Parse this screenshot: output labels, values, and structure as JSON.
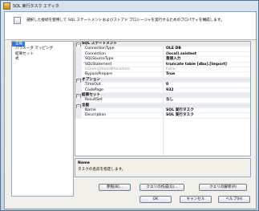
{
  "window": {
    "title": "SQL 実行タスク エディタ"
  },
  "banner": {
    "text": "選択した接続を使用して SQL ステートメントおよびストアド プロシージャを実行するためのプロパティを構成します。"
  },
  "nav": {
    "items": [
      "全般",
      "パラメータ マッピング",
      "結果セット",
      "式"
    ],
    "selected": 0
  },
  "properties": [
    {
      "category": "SQL ステートメント",
      "rows": [
        {
          "name": "ConnectionType",
          "value": "OLE DB"
        },
        {
          "name": "Connection",
          "value": "(local).ssistest"
        },
        {
          "name": "SQLSourceType",
          "value": "直接入力"
        },
        {
          "name": "SQLStatement",
          "value": "truncate table [dbo].[Import]"
        },
        {
          "name": "IsQueryStoredProcedure",
          "value": "False",
          "dim": true
        },
        {
          "name": "BypassPrepare",
          "value": "True"
        }
      ]
    },
    {
      "category": "オプション",
      "rows": [
        {
          "name": "TimeOut",
          "value": "0"
        },
        {
          "name": "CodePage",
          "value": "932"
        }
      ]
    },
    {
      "category": "結果セット",
      "rows": [
        {
          "name": "ResultSet",
          "value": "なし"
        }
      ]
    },
    {
      "category": "全般",
      "rows": [
        {
          "name": "Name",
          "value": "SQL 実行タスク"
        },
        {
          "name": "Description",
          "value": "SQL 実行タスク"
        }
      ]
    }
  ],
  "description": {
    "title": "Name",
    "text": "タスクの名前を指定します。"
  },
  "buttons": {
    "browse": "参照(B)...",
    "build_query": "クエリの作成(Q)...",
    "parse_query": "クエリの解析(P)",
    "ok": "OK",
    "cancel": "キャンセル",
    "help": "ヘルプ(H)"
  }
}
